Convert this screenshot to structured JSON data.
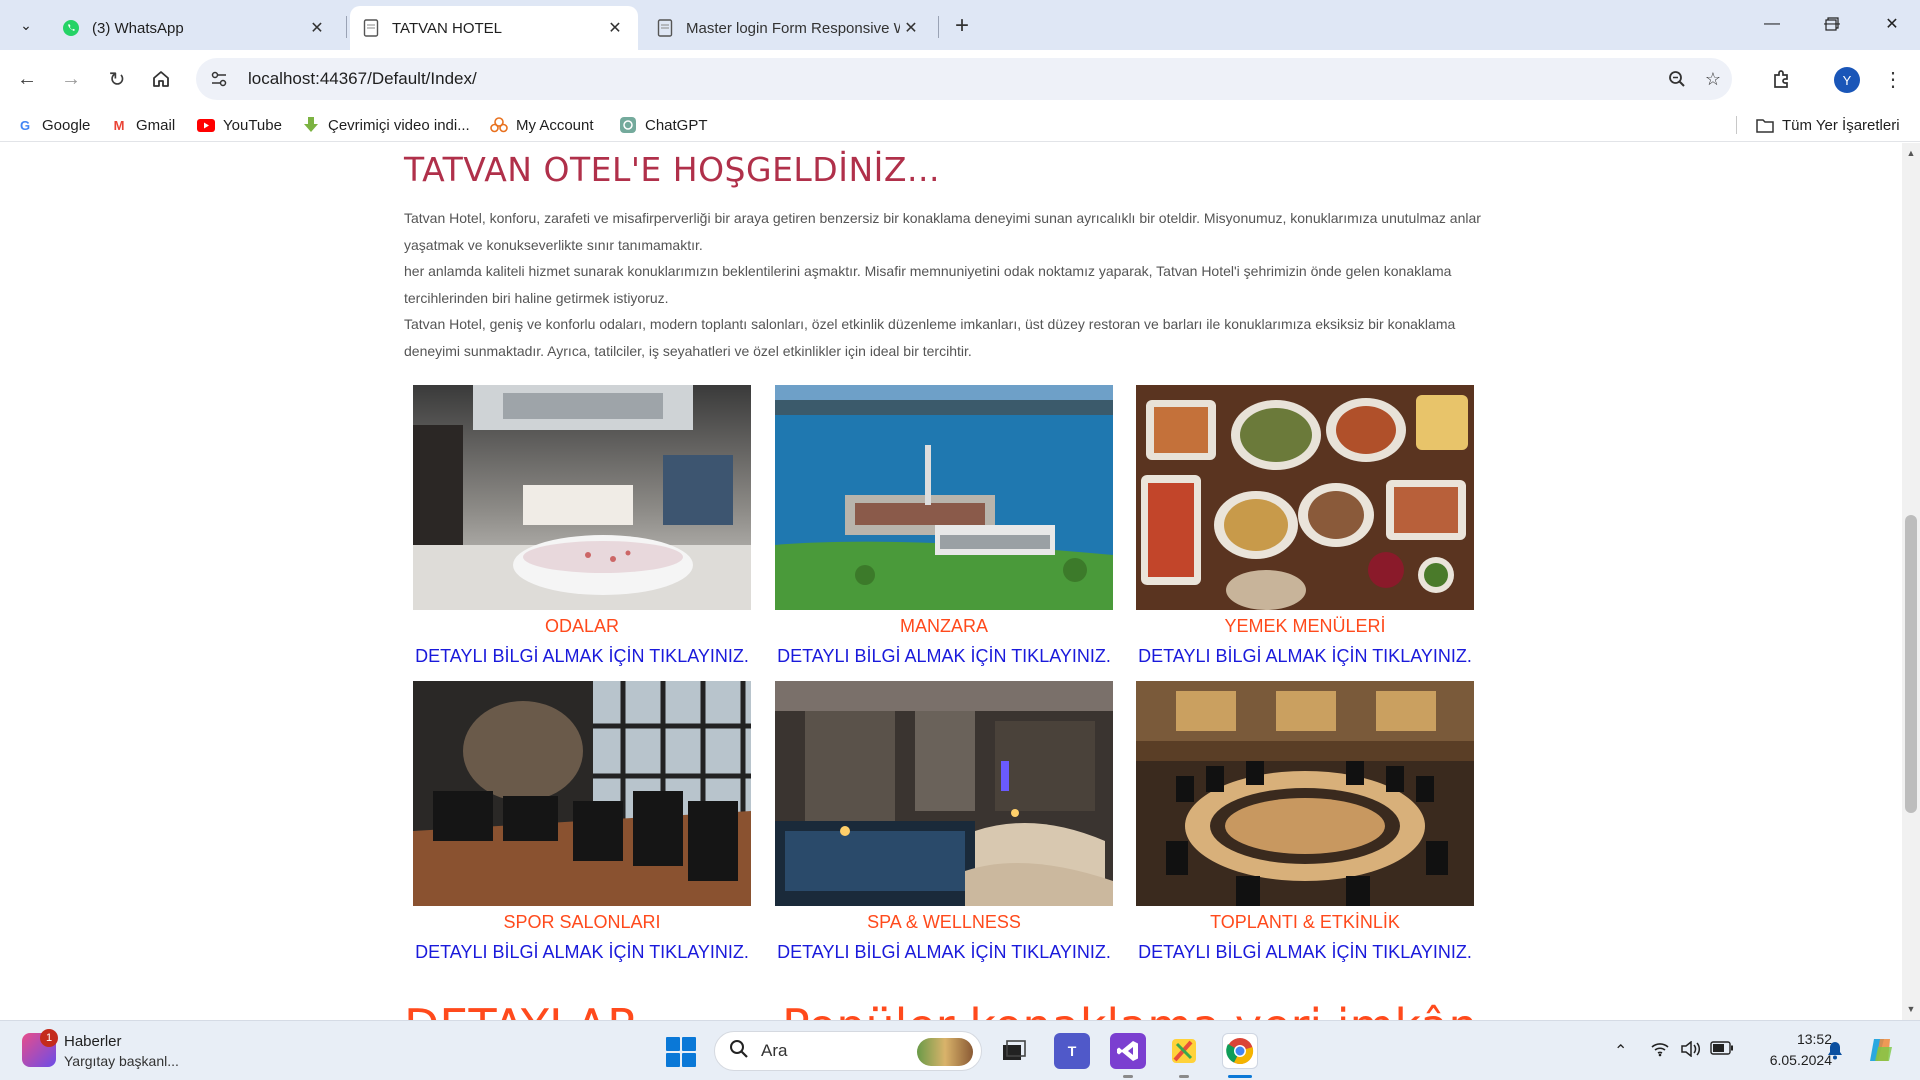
{
  "browser": {
    "tabs": [
      {
        "title": "(3) WhatsApp",
        "icon": "whatsapp-icon",
        "active": false
      },
      {
        "title": "TATVAN HOTEL",
        "icon": "page-icon",
        "active": true
      },
      {
        "title": "Master login Form Responsive W",
        "icon": "page-icon",
        "active": false
      }
    ],
    "url": "localhost:44367/Default/Index/",
    "profile_initial": "Y",
    "bookmarks": [
      {
        "label": "Google",
        "icon": "google-icon"
      },
      {
        "label": "Gmail",
        "icon": "gmail-icon"
      },
      {
        "label": "YouTube",
        "icon": "youtube-icon"
      },
      {
        "label": "Çevrimiçi video indi...",
        "icon": "download-icon"
      },
      {
        "label": "My Account",
        "icon": "account-icon"
      },
      {
        "label": "ChatGPT",
        "icon": "chatgpt-icon"
      }
    ],
    "all_bookmarks_label": "Tüm Yer İşaretleri"
  },
  "page": {
    "welcome_title": "TATVAN OTEL'E HOŞGELDİNİZ...",
    "intro_lines": [
      "Tatvan Hotel, konforu, zarafeti ve misafirperverliği bir araya getiren benzersiz bir konaklama deneyimi sunan ayrıcalıklı bir oteldir. Misyonumuz, konuklarımıza unutulmaz anlar yaşatmak ve konukseverlikte sınır tanımamaktır.",
      "her anlamda kaliteli hizmet sunarak konuklarımızın beklentilerini aşmaktır. Misafir memnuniyetini odak noktamız yaparak, Tatvan Hotel'i şehrimizin önde gelen konaklama tercihlerinden biri haline getirmek istiyoruz.",
      "Tatvan Hotel, geniş ve konforlu odaları, modern toplantı salonları, özel etkinlik düzenleme imkanları, üst düzey restoran ve barları ile konuklarımıza eksiksiz bir konaklama deneyimi sunmaktadır. Ayrıca, tatilciler, iş seyahatleri ve özel etkinlikler için ideal bir tercihtir."
    ],
    "cards": [
      {
        "title": "ODALAR",
        "link": "DETAYLI BİLGİ ALMAK İÇİN TIKLAYINIZ."
      },
      {
        "title": "MANZARA",
        "link": "DETAYLI BİLGİ ALMAK İÇİN TIKLAYINIZ."
      },
      {
        "title": "YEMEK MENÜLERİ",
        "link": "DETAYLI BİLGİ ALMAK İÇİN TIKLAYINIZ."
      },
      {
        "title": "SPOR SALONLARI",
        "link": "DETAYLI BİLGİ ALMAK İÇİN TIKLAYINIZ."
      },
      {
        "title": "SPA & WELLNESS",
        "link": "DETAYLI BİLGİ ALMAK İÇİN TIKLAYINIZ."
      },
      {
        "title": "TOPLANTI & ETKİNLİK",
        "link": "DETAYLI BİLGİ ALMAK İÇİN TIKLAYINIZ."
      }
    ],
    "bottom_heading_left": "DETAYLAR",
    "bottom_heading_right": "Popüler konaklama yeri imkân",
    "colors": {
      "title": "#b0304a",
      "card_title": "#ff4a1c",
      "card_link": "#1a1adb"
    }
  },
  "taskbar": {
    "news_title": "Haberler",
    "news_subtitle": "Yargıtay başkanl...",
    "news_badge": "1",
    "search_placeholder": "Ara",
    "time": "13:52",
    "date": "6.05.2024"
  }
}
